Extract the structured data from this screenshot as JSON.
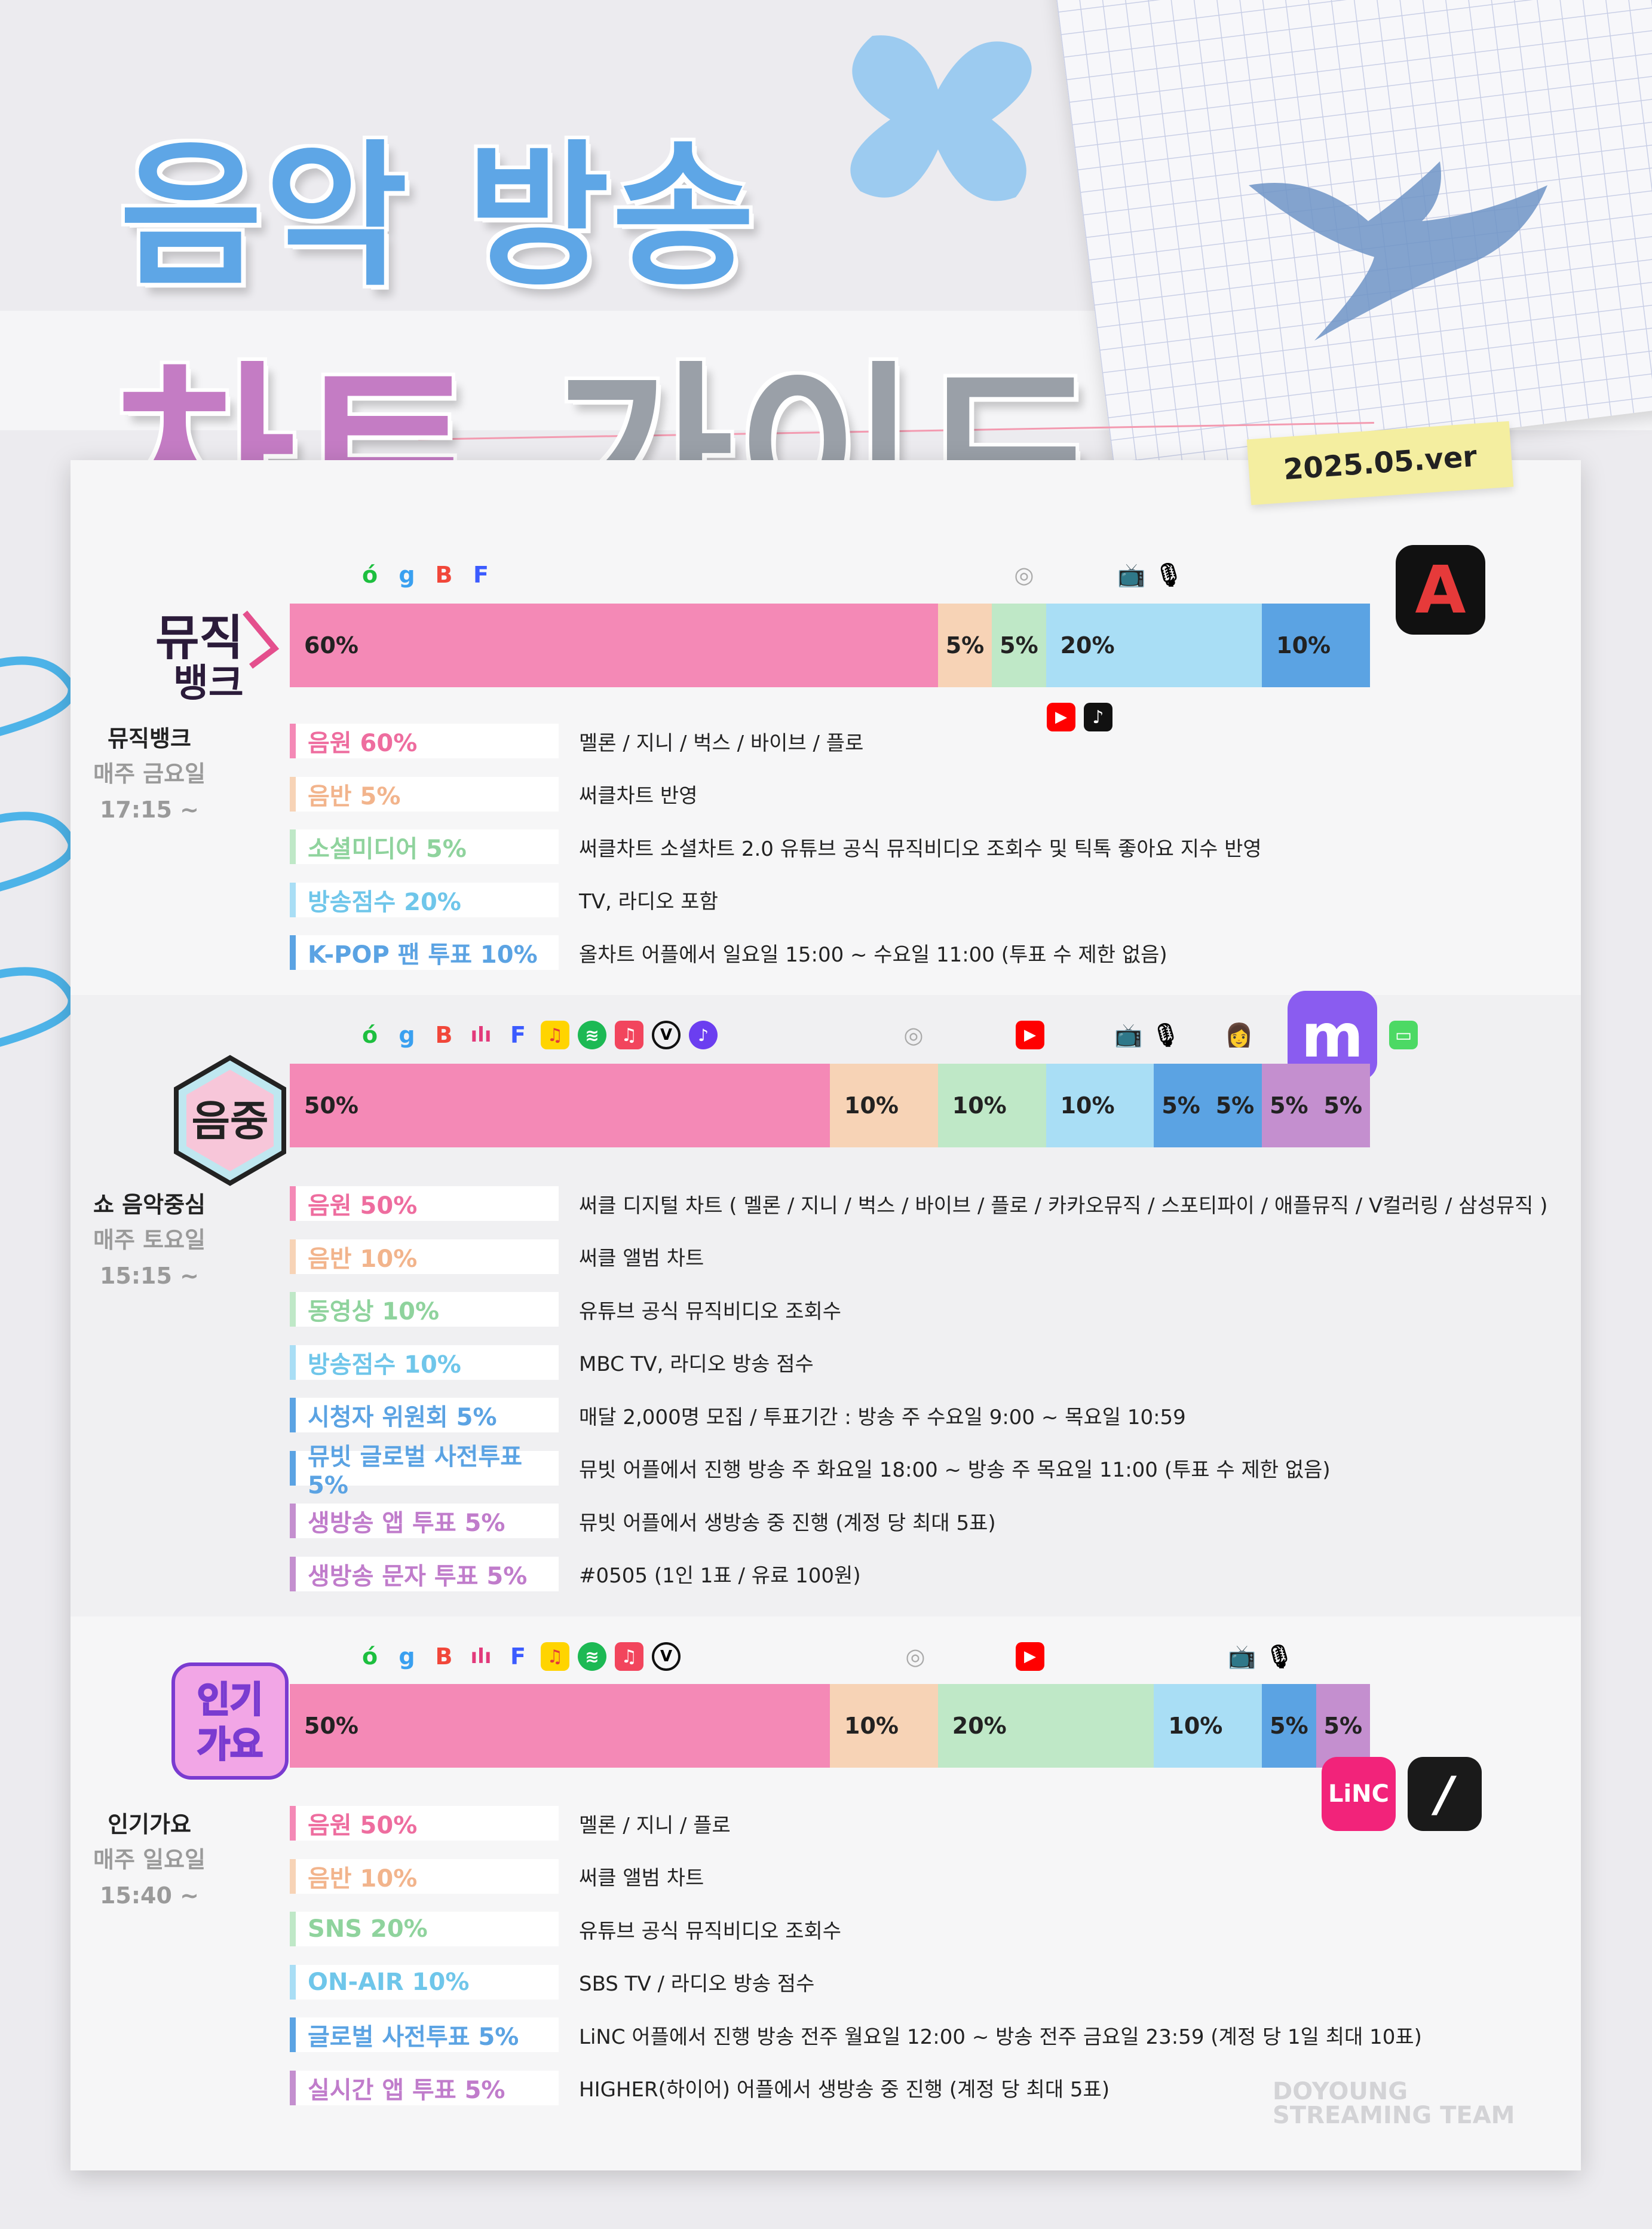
{
  "header": {
    "title_top": "음악 방송",
    "title_bottom_a": "차트",
    "title_bottom_b": "가이드",
    "version": "2025.05.ver"
  },
  "colors": {
    "pink": "#f489b6",
    "peach": "#f7d3b6",
    "mint": "#bfe8c7",
    "sky": "#a9def5",
    "blue": "#5ba3e3",
    "purple": "#c48fcf"
  },
  "musicbank": {
    "logo_text": "뮤직뱅크",
    "name": "뮤직뱅크",
    "day": "매주 금요일",
    "time": "17:15 ~",
    "bar": [
      {
        "label": "60%",
        "value": 60,
        "color": "#f489b6"
      },
      {
        "label": "5%",
        "value": 5,
        "color": "#f7d3b6"
      },
      {
        "label": "5%",
        "value": 5,
        "color": "#bfe8c7"
      },
      {
        "label": "20%",
        "value": 20,
        "color": "#a9def5"
      },
      {
        "label": "10%",
        "value": 10,
        "color": "#5ba3e3"
      }
    ],
    "items": [
      {
        "label": "음원 60%",
        "desc": "멜론 / 지니 / 벅스 / 바이브 / 플로",
        "color": "#f489b6",
        "text": "#ee6d9f"
      },
      {
        "label": "음반 5%",
        "desc": "써클차트 반영",
        "color": "#f7d3b6",
        "text": "#f2b48c"
      },
      {
        "label": "소셜미디어 5%",
        "desc": "써클차트 소셜차트 2.0 유튜브 공식 뮤직비디오 조회수 및 틱톡 좋아요 지수 반영",
        "color": "#bfe8c7",
        "text": "#8fd39d"
      },
      {
        "label": "방송점수 20%",
        "desc": "TV, 라디오 포함",
        "color": "#a9def5",
        "text": "#6fc6ea"
      },
      {
        "label": "K-POP 팬 투표 10%",
        "desc": "올차트 어플에서 일요일 15:00 ~ 수요일 11:00 (투표 수 제한 없음)",
        "color": "#5ba3e3",
        "text": "#5ba3e3"
      }
    ]
  },
  "musiccore": {
    "logo_text": "음중",
    "name": "쇼 음악중심",
    "day": "매주 토요일",
    "time": "15:15 ~",
    "bar": [
      {
        "label": "50%",
        "value": 50,
        "color": "#f489b6"
      },
      {
        "label": "10%",
        "value": 10,
        "color": "#f7d3b6"
      },
      {
        "label": "10%",
        "value": 10,
        "color": "#bfe8c7"
      },
      {
        "label": "10%",
        "value": 10,
        "color": "#a9def5"
      },
      {
        "label": "5%",
        "value": 5,
        "color": "#5ba3e3"
      },
      {
        "label": "5%",
        "value": 5,
        "color": "#5ba3e3"
      },
      {
        "label": "5%",
        "value": 5,
        "color": "#c48fcf"
      },
      {
        "label": "5%",
        "value": 5,
        "color": "#c48fcf"
      }
    ],
    "items": [
      {
        "label": "음원 50%",
        "desc": "써클 디지털 차트 ( 멜론 / 지니 / 벅스 / 바이브 / 플로 / 카카오뮤직 / 스포티파이 / 애플뮤직 / V컬러링 / 삼성뮤직 )",
        "color": "#f489b6",
        "text": "#ee6d9f"
      },
      {
        "label": "음반 10%",
        "desc": "써클 앨범 차트",
        "color": "#f7d3b6",
        "text": "#f2b48c"
      },
      {
        "label": "동영상 10%",
        "desc": "유튜브 공식 뮤직비디오 조회수",
        "color": "#bfe8c7",
        "text": "#8fd39d"
      },
      {
        "label": "방송점수 10%",
        "desc": "MBC TV, 라디오 방송 점수",
        "color": "#a9def5",
        "text": "#6fc6ea"
      },
      {
        "label": "시청자 위원회 5%",
        "desc": "매달 2,000명 모집 / 투표기간 : 방송 주 수요일 9:00 ~ 목요일 10:59",
        "color": "#5ba3e3",
        "text": "#5ba3e3"
      },
      {
        "label": "뮤빗 글로벌 사전투표 5%",
        "desc": "뮤빗 어플에서 진행 방송 주 화요일 18:00 ~ 방송 주 목요일 11:00 (투표 수 제한 없음)",
        "color": "#5ba3e3",
        "text": "#5ba3e3"
      },
      {
        "label": "생방송 앱 투표 5%",
        "desc": "뮤빗 어플에서 생방송 중 진행 (계정 당 최대 5표)",
        "color": "#c48fcf",
        "text": "#c07ccb"
      },
      {
        "label": "생방송 문자 투표 5%",
        "desc": "#0505 (1인 1표 / 유료 100원)",
        "color": "#c48fcf",
        "text": "#c07ccb"
      }
    ]
  },
  "inkigayo": {
    "logo_text": "인기가요",
    "name": "인기가요",
    "day": "매주 일요일",
    "time": "15:40 ~",
    "bar": [
      {
        "label": "50%",
        "value": 50,
        "color": "#f489b6"
      },
      {
        "label": "10%",
        "value": 10,
        "color": "#f7d3b6"
      },
      {
        "label": "20%",
        "value": 20,
        "color": "#bfe8c7"
      },
      {
        "label": "10%",
        "value": 10,
        "color": "#a9def5"
      },
      {
        "label": "5%",
        "value": 5,
        "color": "#5ba3e3"
      },
      {
        "label": "5%",
        "value": 5,
        "color": "#c48fcf"
      }
    ],
    "items": [
      {
        "label": "음원 50%",
        "desc": "멜론 / 지니 / 플로",
        "color": "#f489b6",
        "text": "#ee6d9f"
      },
      {
        "label": "음반 10%",
        "desc": "써클 앨범 차트",
        "color": "#f7d3b6",
        "text": "#f2b48c"
      },
      {
        "label": "SNS 20%",
        "desc": "유튜브 공식 뮤직비디오 조회수",
        "color": "#bfe8c7",
        "text": "#8fd39d"
      },
      {
        "label": "ON-AIR 10%",
        "desc": "SBS TV / 라디오 방송 점수",
        "color": "#a9def5",
        "text": "#6fc6ea"
      },
      {
        "label": "글로벌 사전투표 5%",
        "desc": "LiNC 어플에서 진행 방송 전주 월요일 12:00 ~ 방송 전주 금요일 23:59 (계정 당 1일 최대 10표)",
        "color": "#5ba3e3",
        "text": "#5ba3e3"
      },
      {
        "label": "실시간 앱 투표 5%",
        "desc": "HIGHER(하이어) 어플에서 생방송 중 진행 (계정 당 최대 5표)",
        "color": "#c48fcf",
        "text": "#c07ccb"
      }
    ]
  },
  "apps": {
    "allchart": "A",
    "mubeat": "m",
    "linc": "LiNC",
    "higher": "/"
  },
  "watermark": {
    "line1": "DOYOUNG",
    "line2": "STREAMING TEAM"
  }
}
